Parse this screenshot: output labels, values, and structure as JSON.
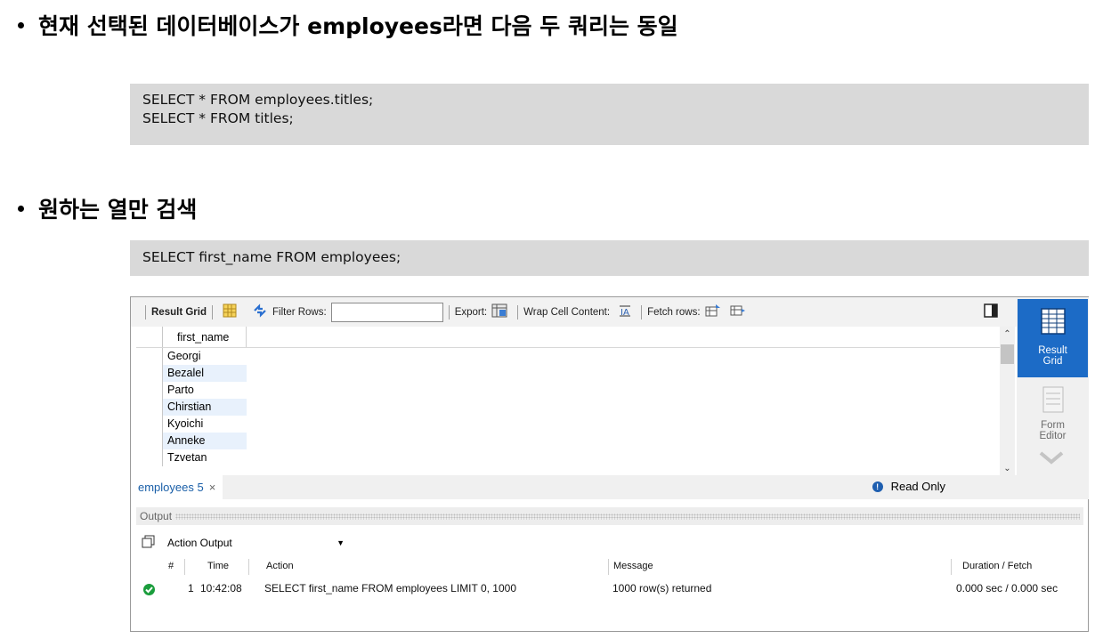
{
  "slide": {
    "heading1": "현재 선택된 데이터베이스가 employees라면 다음 두 쿼리는 동일",
    "code1_line1": "SELECT * FROM employees.titles;",
    "code1_line2": "SELECT * FROM titles;",
    "heading2": "원하는 열만 검색",
    "code2": "SELECT first_name FROM employees;"
  },
  "toolbar": {
    "result_grid": "Result Grid",
    "filter_rows": "Filter Rows:",
    "export": "Export:",
    "wrap_cell": "Wrap Cell Content:",
    "fetch_rows": "Fetch rows:"
  },
  "grid": {
    "column": "first_name",
    "rows": [
      "Georgi",
      "Bezalel",
      "Parto",
      "Chirstian",
      "Kyoichi",
      "Anneke",
      "Tzvetan"
    ]
  },
  "tabs": {
    "active": "employees 5",
    "close": "×",
    "status": "Read Only"
  },
  "sidebar": {
    "result_line1": "Result",
    "result_line2": "Grid",
    "form_line1": "Form",
    "form_line2": "Editor"
  },
  "output": {
    "title": "Output",
    "select": "Action Output",
    "headers": {
      "num": "#",
      "time": "Time",
      "action": "Action",
      "message": "Message",
      "duration": "Duration / Fetch"
    },
    "row": {
      "num": "1",
      "time": "10:42:08",
      "action": "SELECT first_name FROM employees LIMIT 0, 1000",
      "message": "1000 row(s) returned",
      "duration": "0.000 sec / 0.000 sec"
    }
  },
  "colors": {
    "accent": "#1c6bc6",
    "code_bg": "#d9d9d9",
    "success": "#1a9d3c"
  }
}
